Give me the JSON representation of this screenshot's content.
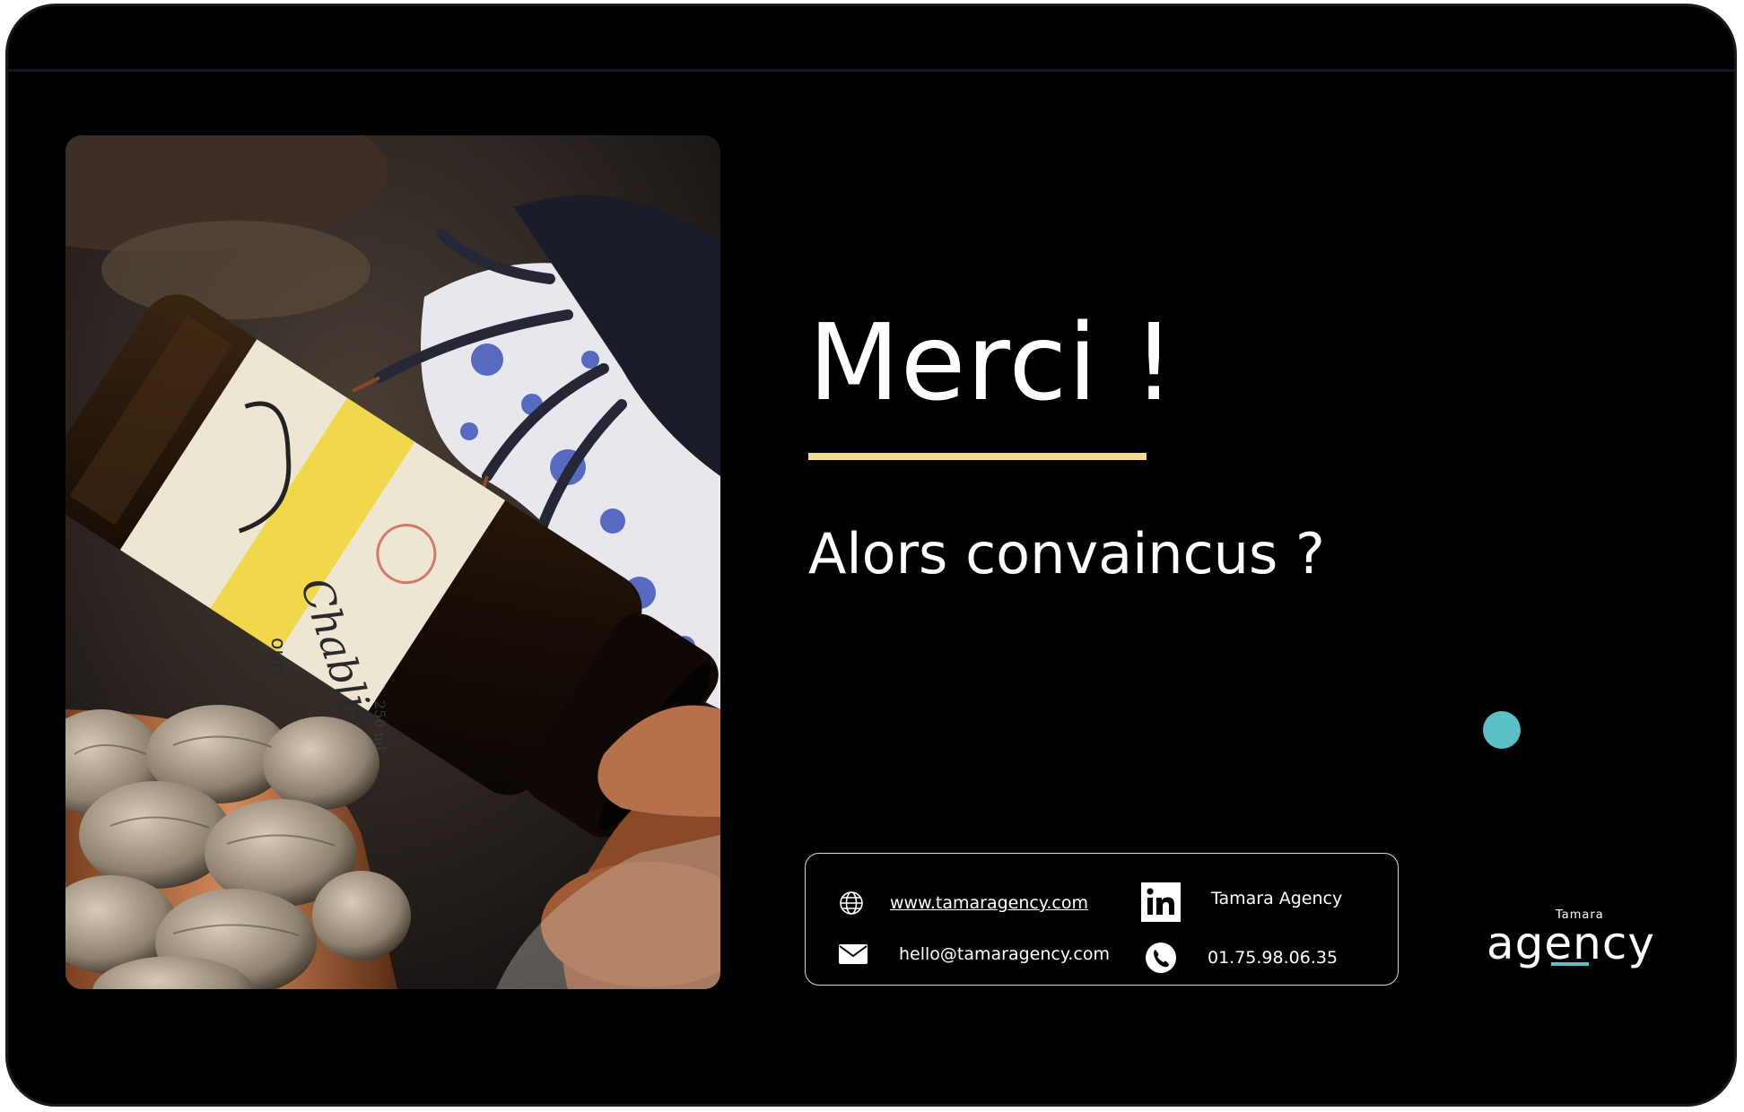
{
  "slide": {
    "title": "Merci !",
    "subtitle": "Alors convaincus ?"
  },
  "contact": {
    "website": "www.tamaragency.com",
    "email": "hello@tamaragency.com",
    "linkedin": "Tamara Agency",
    "phone": "01.75.98.06.35"
  },
  "logo": {
    "small": "Tamara",
    "big": "agency"
  },
  "photo": {
    "label_script": "Chablis",
    "label_text_1": "oup",
    "label_text_2": "250 ml"
  },
  "icons": [
    "globe-icon",
    "mail-icon",
    "linkedin-icon",
    "phone-icon"
  ],
  "colors": {
    "background": "#000000",
    "accent_yellow": "#f1dc8a",
    "accent_teal": "#5bc0c8",
    "text": "#ffffff"
  }
}
